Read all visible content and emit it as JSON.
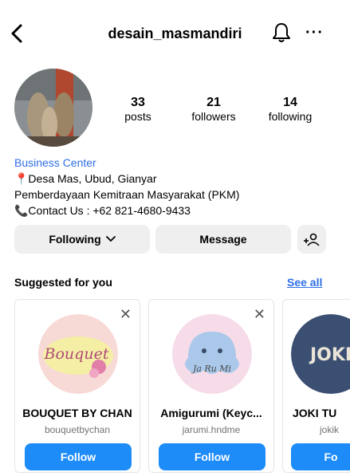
{
  "header": {
    "username": "desain_masmandiri",
    "back_icon": "chevron-left-icon",
    "bell_icon": "bell-icon",
    "more_icon": "more-icon",
    "more_glyph": "···"
  },
  "profile": {
    "stats": [
      {
        "value": "33",
        "label": "posts"
      },
      {
        "value": "21",
        "label": "followers"
      },
      {
        "value": "14",
        "label": "following"
      }
    ],
    "bio": {
      "category": "Business Center",
      "location": "📍Desa Mas, Ubud, Gianyar",
      "line2": "Pemberdayaan Kemitraan Masyarakat (PKM)",
      "contact": "📞Contact Us : +62 821-4680-9433"
    }
  },
  "actions": {
    "following_label": "Following",
    "message_label": "Message",
    "add_user_icon": "add-user-icon"
  },
  "suggested": {
    "title": "Suggested for you",
    "see_all": "See all",
    "close_glyph": "✕",
    "cards": [
      {
        "name": "BOUQUET BY CHAN",
        "handle": "bouquetbychan",
        "follow": "Follow",
        "logo_text": "Bouquet"
      },
      {
        "name": "Amigurumi (Keyc...",
        "handle": "jarumi.hndme",
        "follow": "Follow",
        "logo_text": "Ja Ru Mi"
      },
      {
        "name": "JOKI TU",
        "handle": "jokik",
        "follow": "Fo",
        "logo_text": "JOKI"
      }
    ]
  },
  "colors": {
    "accent": "#1d8cf8",
    "link": "#2e6ee6",
    "button_gray": "#efefef"
  }
}
